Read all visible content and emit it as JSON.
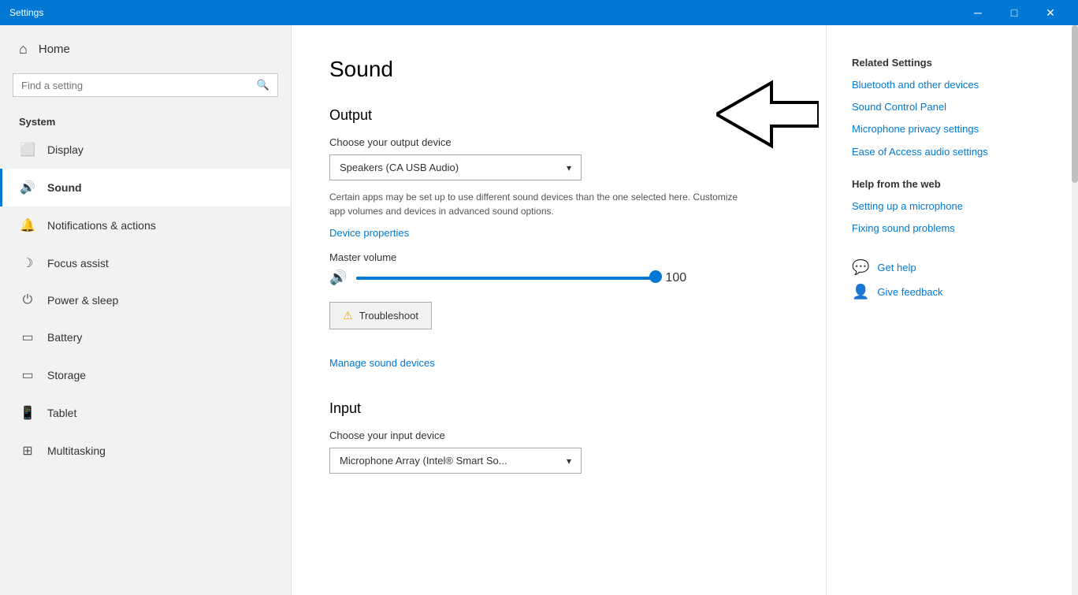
{
  "titleBar": {
    "title": "Settings",
    "minimize": "─",
    "maximize": "□",
    "close": "✕"
  },
  "sidebar": {
    "homeLabel": "Home",
    "searchPlaceholder": "Find a setting",
    "sectionTitle": "System",
    "items": [
      {
        "id": "display",
        "icon": "🖥",
        "label": "Display"
      },
      {
        "id": "sound",
        "icon": "🔊",
        "label": "Sound"
      },
      {
        "id": "notifications",
        "icon": "🔔",
        "label": "Notifications & actions"
      },
      {
        "id": "focus",
        "icon": "🌙",
        "label": "Focus assist"
      },
      {
        "id": "power",
        "icon": "⏻",
        "label": "Power & sleep"
      },
      {
        "id": "battery",
        "icon": "🔋",
        "label": "Battery"
      },
      {
        "id": "storage",
        "icon": "💾",
        "label": "Storage"
      },
      {
        "id": "tablet",
        "icon": "📱",
        "label": "Tablet"
      },
      {
        "id": "multitasking",
        "icon": "⊟",
        "label": "Multitasking"
      }
    ]
  },
  "main": {
    "pageTitle": "Sound",
    "output": {
      "sectionTitle": "Output",
      "deviceLabel": "Choose your output device",
      "deviceValue": "Speakers (CA USB Audio)",
      "infoText": "Certain apps may be set up to use different sound devices than the one selected here. Customize app volumes and devices in advanced sound options.",
      "devicePropertiesLink": "Device properties",
      "masterVolumeLabel": "Master volume",
      "volumeValue": "100",
      "troubleshootLabel": "Troubleshoot",
      "manageSoundLink": "Manage sound devices"
    },
    "input": {
      "sectionTitle": "Input",
      "deviceLabel": "Choose your input device",
      "deviceValue": "Microphone Array (Intel® Smart So..."
    }
  },
  "rightPanel": {
    "relatedTitle": "Related Settings",
    "links": [
      {
        "id": "bluetooth",
        "label": "Bluetooth and other devices"
      },
      {
        "id": "soundcontrol",
        "label": "Sound Control Panel"
      },
      {
        "id": "microprivacy",
        "label": "Microphone privacy settings"
      },
      {
        "id": "easeaccess",
        "label": "Ease of Access audio settings"
      }
    ],
    "helpTitle": "Help from the web",
    "helpLinks": [
      {
        "id": "setupmic",
        "label": "Setting up a microphone"
      },
      {
        "id": "fixsound",
        "label": "Fixing sound problems"
      }
    ],
    "getHelp": "Get help",
    "giveFeedback": "Give feedback"
  }
}
